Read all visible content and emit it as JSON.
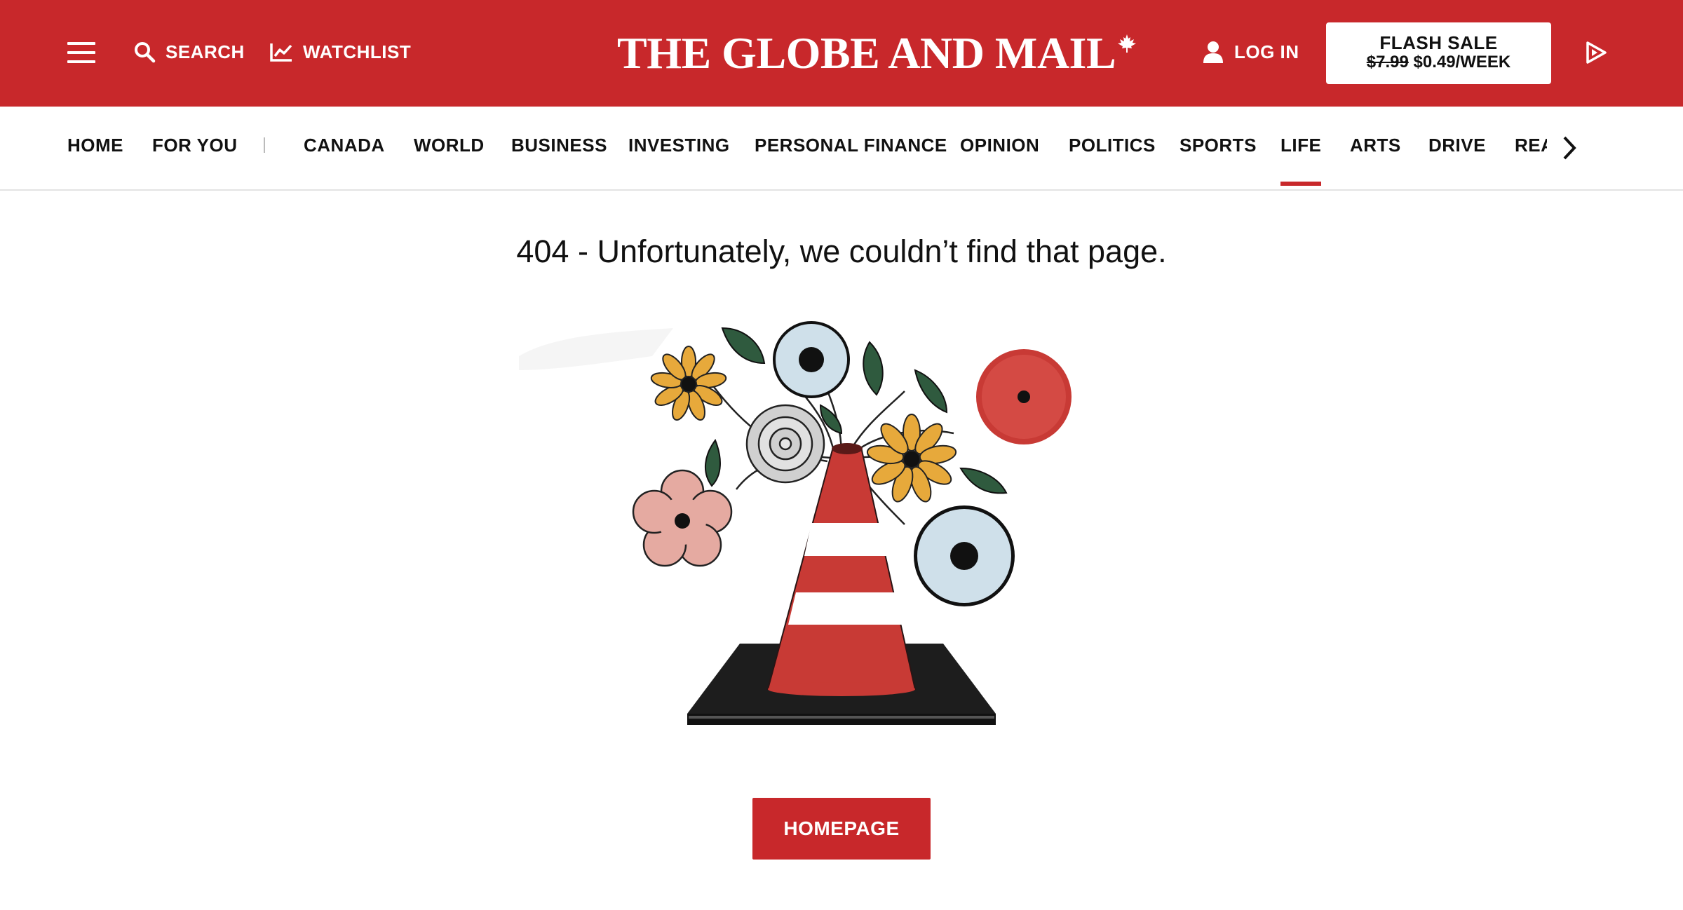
{
  "header": {
    "menu_icon": "hamburger-menu-icon",
    "search_label": "SEARCH",
    "search_icon": "search-icon",
    "watchlist_label": "WATCHLIST",
    "watchlist_icon": "trend-chart-icon",
    "logo_text": "THE GLOBE AND MAIL",
    "logo_icon": "maple-leaf-icon",
    "login_label": "LOG IN",
    "login_icon": "user-icon",
    "flash_sale": {
      "title": "FLASH SALE",
      "old_price": "$7.99",
      "new_price": "$0.49/WEEK"
    },
    "play_icon": "play-outline-icon",
    "brand_color": "#c8282b"
  },
  "nav": {
    "items": [
      {
        "label": "HOME"
      },
      {
        "label": "FOR YOU"
      },
      {
        "label": "CANADA"
      },
      {
        "label": "WORLD"
      },
      {
        "label": "BUSINESS"
      },
      {
        "label": "INVESTING"
      },
      {
        "label": "PERSONAL FINANCE"
      },
      {
        "label": "OPINION"
      },
      {
        "label": "POLITICS"
      },
      {
        "label": "SPORTS"
      },
      {
        "label": "LIFE",
        "active": true
      },
      {
        "label": "ARTS"
      },
      {
        "label": "DRIVE"
      },
      {
        "label": "REAL ESTATE"
      }
    ],
    "next_icon": "chevron-right-icon"
  },
  "main": {
    "error_message": "404 - Unfortunately, we couldn’t find that page.",
    "illustration": "traffic-cone-flower-vase-illustration",
    "homepage_button": "HOMEPAGE"
  }
}
